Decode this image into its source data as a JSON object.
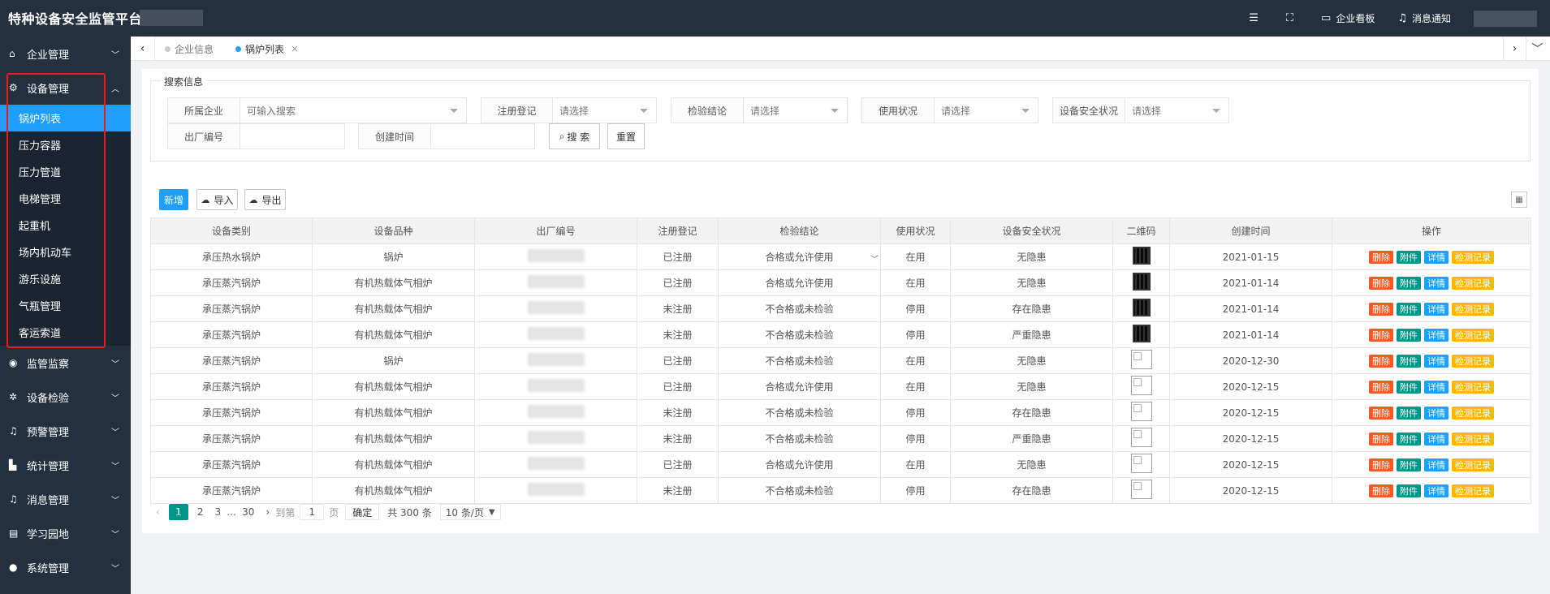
{
  "app": {
    "title": "特种设备安全监管平台"
  },
  "header": {
    "actions": [
      {
        "icon": "list-icon",
        "label": ""
      },
      {
        "icon": "fullscreen-icon",
        "label": ""
      },
      {
        "icon": "monitor-icon",
        "label": "企业看板"
      },
      {
        "icon": "bell-icon",
        "label": "消息通知"
      }
    ]
  },
  "sidebar": {
    "items": [
      {
        "label": "企业管理",
        "icon": "home-icon",
        "expanded": false
      },
      {
        "label": "设备管理",
        "icon": "gear-icon",
        "expanded": true
      },
      {
        "label": "监管监察",
        "icon": "eye-icon",
        "expanded": false
      },
      {
        "label": "设备检验",
        "icon": "bug-icon",
        "expanded": false
      },
      {
        "label": "预警管理",
        "icon": "bell-icon",
        "expanded": false
      },
      {
        "label": "统计管理",
        "icon": "chart-icon",
        "expanded": false
      },
      {
        "label": "消息管理",
        "icon": "bell-icon",
        "expanded": false
      },
      {
        "label": "学习园地",
        "icon": "book-icon",
        "expanded": false
      },
      {
        "label": "系统管理",
        "icon": "user-icon",
        "expanded": false
      }
    ],
    "submenu": [
      {
        "label": "锅炉列表",
        "active": true
      },
      {
        "label": "压力容器",
        "active": false
      },
      {
        "label": "压力管道",
        "active": false
      },
      {
        "label": "电梯管理",
        "active": false
      },
      {
        "label": "起重机",
        "active": false
      },
      {
        "label": "场内机动车",
        "active": false
      },
      {
        "label": "游乐设施",
        "active": false
      },
      {
        "label": "气瓶管理",
        "active": false
      },
      {
        "label": "客运索道",
        "active": false
      }
    ]
  },
  "tabs": [
    {
      "label": "企业信息",
      "active": false
    },
    {
      "label": "锅炉列表",
      "active": true,
      "close": "×"
    }
  ],
  "search": {
    "legend": "搜索信息",
    "fields": {
      "company": {
        "label": "所属企业",
        "placeholder": "可输入搜索"
      },
      "registration": {
        "label": "注册登记",
        "placeholder": "请选择"
      },
      "inspection": {
        "label": "检验结论",
        "placeholder": "请选择"
      },
      "usage": {
        "label": "使用状况",
        "placeholder": "请选择"
      },
      "safety": {
        "label": "设备安全状况",
        "placeholder": "请选择"
      },
      "factory_no": {
        "label": "出厂编号",
        "placeholder": ""
      },
      "created": {
        "label": "创建时间",
        "placeholder": ""
      }
    },
    "search_button": "搜 索",
    "reset_button": "重置"
  },
  "toolbar": {
    "new": "新增",
    "import": "导入",
    "export": "导出"
  },
  "table": {
    "columns": [
      "设备类别",
      "设备品种",
      "出厂编号",
      "注册登记",
      "检验结论",
      "使用状况",
      "设备安全状况",
      "二维码",
      "创建时间",
      "操作"
    ],
    "rows": [
      {
        "category": "承压热水锅炉",
        "variety": "锅炉",
        "registration": "已注册",
        "inspection": "合格或允许使用",
        "usage": "在用",
        "safety": "无隐患",
        "qr": "qr",
        "created": "2021-01-15"
      },
      {
        "category": "承压蒸汽锅炉",
        "variety": "有机热载体气相炉",
        "registration": "已注册",
        "inspection": "合格或允许使用",
        "usage": "在用",
        "safety": "无隐患",
        "qr": "qr",
        "created": "2021-01-14"
      },
      {
        "category": "承压蒸汽锅炉",
        "variety": "有机热载体气相炉",
        "registration": "未注册",
        "inspection": "不合格或未检验",
        "usage": "停用",
        "safety": "存在隐患",
        "qr": "qr",
        "created": "2021-01-14"
      },
      {
        "category": "承压蒸汽锅炉",
        "variety": "有机热载体气相炉",
        "registration": "未注册",
        "inspection": "不合格或未检验",
        "usage": "停用",
        "safety": "严重隐患",
        "qr": "qr",
        "created": "2021-01-14"
      },
      {
        "category": "承压蒸汽锅炉",
        "variety": "锅炉",
        "registration": "已注册",
        "inspection": "不合格或未检验",
        "usage": "在用",
        "safety": "无隐患",
        "qr": "broken",
        "created": "2020-12-30"
      },
      {
        "category": "承压蒸汽锅炉",
        "variety": "有机热载体气相炉",
        "registration": "已注册",
        "inspection": "合格或允许使用",
        "usage": "在用",
        "safety": "无隐患",
        "qr": "broken",
        "created": "2020-12-15"
      },
      {
        "category": "承压蒸汽锅炉",
        "variety": "有机热载体气相炉",
        "registration": "未注册",
        "inspection": "不合格或未检验",
        "usage": "停用",
        "safety": "存在隐患",
        "qr": "broken",
        "created": "2020-12-15"
      },
      {
        "category": "承压蒸汽锅炉",
        "variety": "有机热载体气相炉",
        "registration": "未注册",
        "inspection": "不合格或未检验",
        "usage": "停用",
        "safety": "严重隐患",
        "qr": "broken",
        "created": "2020-12-15"
      },
      {
        "category": "承压蒸汽锅炉",
        "variety": "有机热载体气相炉",
        "registration": "已注册",
        "inspection": "合格或允许使用",
        "usage": "在用",
        "safety": "无隐患",
        "qr": "broken",
        "created": "2020-12-15"
      },
      {
        "category": "承压蒸汽锅炉",
        "variety": "有机热载体气相炉",
        "registration": "未注册",
        "inspection": "不合格或未检验",
        "usage": "停用",
        "safety": "存在隐患",
        "qr": "broken",
        "created": "2020-12-15"
      }
    ],
    "ops": {
      "delete": "删除",
      "attach": "附件",
      "detail": "详情",
      "records": "检测记录"
    }
  },
  "pager": {
    "prev": "‹",
    "next": "›",
    "pages": [
      "2",
      "3"
    ],
    "current": "1",
    "ellipsis": "…",
    "last": "30",
    "goto_label": "到第",
    "goto_value": "1",
    "page_unit": "页",
    "confirm": "确定",
    "total": "共 300 条",
    "page_size": "10 条/页"
  },
  "colors": {
    "primary": "#1e9fff",
    "sidebar": "#23303f",
    "teal": "#009688",
    "danger": "#ff5722",
    "warn": "#ffb800",
    "highlight_border": "#e02020"
  }
}
